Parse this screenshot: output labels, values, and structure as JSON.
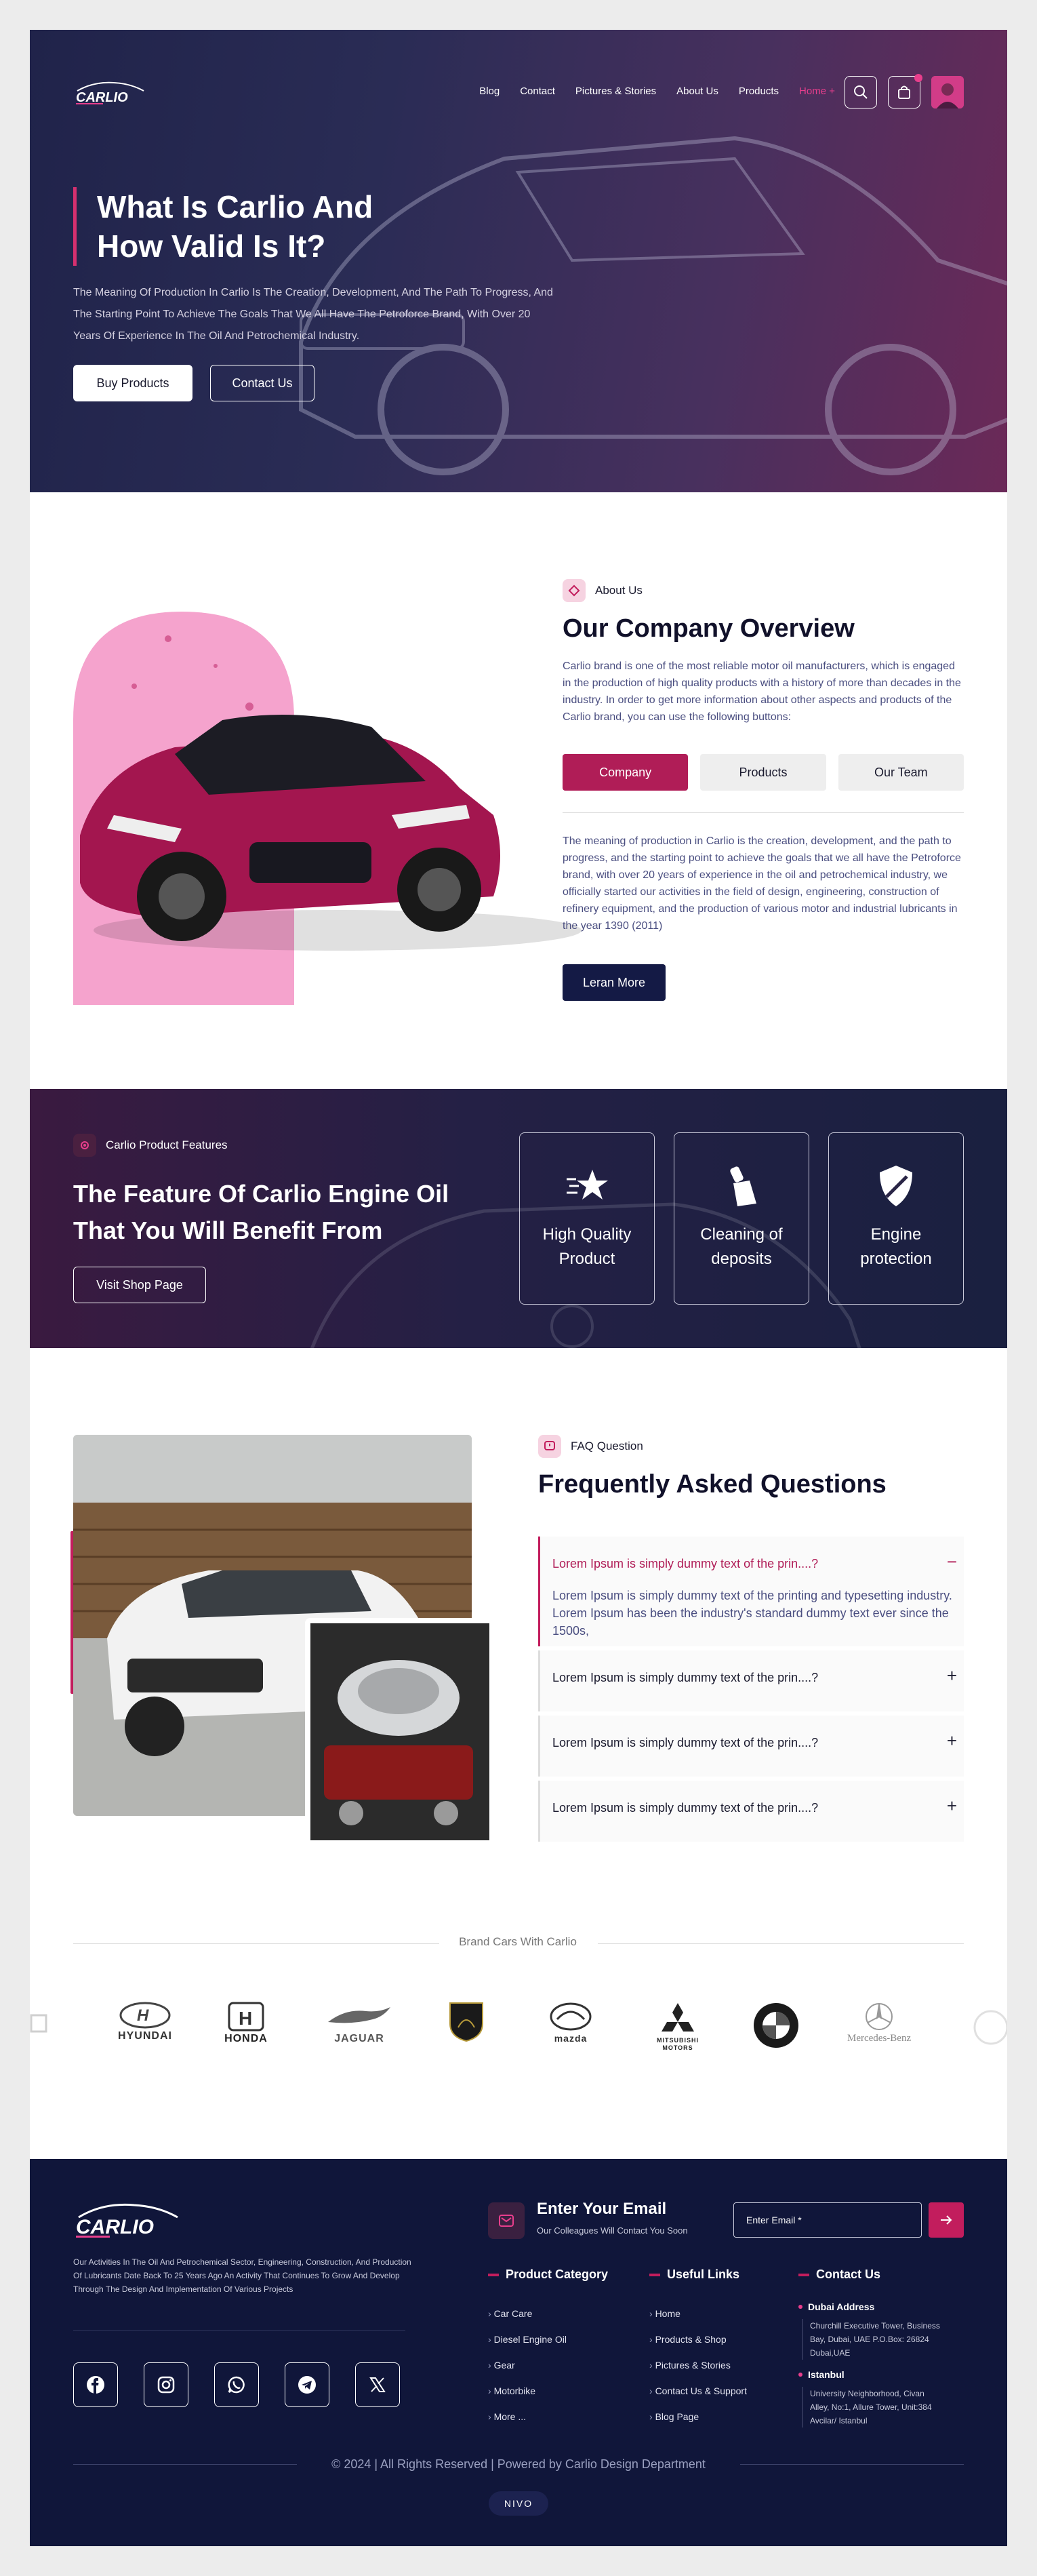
{
  "header": {
    "logo": "CARLIO",
    "menu": [
      "Blog",
      "Contact",
      "Pictures & Stories",
      "About Us",
      "Products",
      "Home +"
    ],
    "cart_count": "0"
  },
  "hero": {
    "title_line1": "What Is Carlio And",
    "title_line2": "How Valid Is It?",
    "text": "The Meaning Of Production In Carlio Is The Creation, Development, And The Path To Progress, And The Starting Point To Achieve The Goals That We All Have The Petroforce Brand, With Over 20 Years Of Experience In The Oil And Petrochemical Industry.",
    "primary_button": "Buy Products",
    "secondary_button": "Contact Us"
  },
  "about": {
    "tag": "About Us",
    "title": "Our Company Overview",
    "text": "Carlio brand is one of the most reliable motor oil manufacturers, which is engaged in the production of high quality products with a history of more than decades in the industry. In order to get more information about other aspects and products of the Carlio brand, you can use the following buttons:",
    "tabs": [
      "Company",
      "Products",
      "Our Team"
    ],
    "paragraph": "The meaning of production in Carlio is the creation, development, and the path to progress, and the starting point to achieve the goals that we all have the Petroforce brand, with over 20 years of experience in the oil and petrochemical industry, we officially started our activities in the field of design, engineering, construction of refinery equipment, and the production of various motor and industrial lubricants in the year 1390 (2011)",
    "button": "Leran More"
  },
  "features": {
    "tag": "Carlio Product Features",
    "title": "The Feature Of Carlio Engine Oil That You Will Benefit From",
    "button": "Visit Shop Page",
    "cards": [
      {
        "line1": "High Quality",
        "line2": "Product",
        "icon": "star-speed-icon"
      },
      {
        "line1": "Cleaning of",
        "line2": "deposits",
        "icon": "brush-icon"
      },
      {
        "line1": "Engine",
        "line2": "protection",
        "icon": "shield-icon"
      }
    ]
  },
  "faq": {
    "tag": "FAQ Question",
    "title": "Frequently Asked Questions",
    "items": [
      {
        "q": "Lorem Ipsum is simply dummy text of the prin....?",
        "a": "Lorem Ipsum is simply dummy text of the printing and typesetting industry. Lorem Ipsum has been the industry's standard dummy text ever since the 1500s,",
        "sign": "−"
      },
      {
        "q": "Lorem Ipsum is simply dummy text of the prin....?",
        "sign": "+"
      },
      {
        "q": "Lorem Ipsum is simply dummy text of the prin....?",
        "sign": "+"
      },
      {
        "q": "Lorem Ipsum is simply dummy text of the prin....?",
        "sign": "+"
      }
    ]
  },
  "brands": {
    "title": "Brand Cars With Carlio",
    "items": [
      "HYUNDAI",
      "HONDA",
      "JAGUAR",
      "",
      "mazda",
      "MITSUBISHI MOTORS",
      "",
      "Mercedes-Benz"
    ]
  },
  "footer": {
    "logo": "CARLIO",
    "description": "Our Activities In The Oil And Petrochemical Sector, Engineering, Construction, And Production Of Lubricants Date Back To 25 Years Ago An Activity That Continues To Grow And Develop Through The Design And Implementation Of Various Projects",
    "newsletter_title": "Enter Your Email",
    "newsletter_sub": "Our Colleagues Will Contact You Soon",
    "email_placeholder": "Enter Email *",
    "col1_title": "Product Category",
    "col1_items": [
      "Car Care",
      "Diesel Engine Oil",
      "Gear",
      "Motorbike",
      "More ..."
    ],
    "col2_title": "Useful Links",
    "col2_items": [
      "Home",
      "Products & Shop",
      "Pictures & Stories",
      "Contact Us & Support",
      "Blog Page"
    ],
    "col3_title": "Contact Us",
    "address1_title": "Dubai Address",
    "address1": "Churchill Executive Tower, Business Bay, Dubai, UAE P.O.Box: 26824 Dubai,UAE",
    "address2_title": "Istanbul",
    "address2": "University Neighborhood, Civan Alley, No:1, Allure Tower, Unit:384 Avcilar/ Istanbul",
    "copyright": "© 2024 | All Rights Reserved | Powered by Carlio Design Department",
    "badge": "NIVO"
  },
  "colors": {
    "accent": "#c21d5d",
    "navy": "#10163a",
    "pink": "#e83e8c"
  }
}
